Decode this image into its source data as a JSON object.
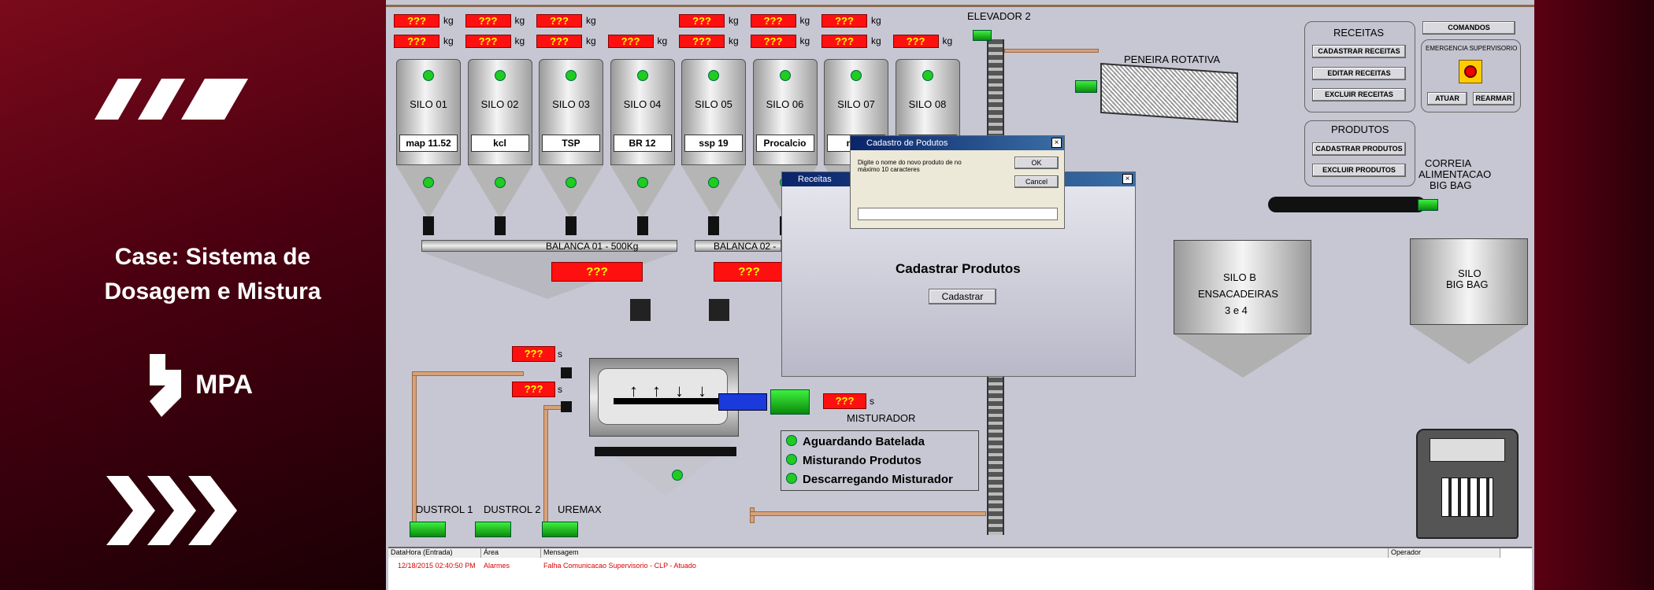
{
  "promo": {
    "title_line1": "Case: Sistema de",
    "title_line2": "Dosagem e Mistura",
    "logo_text": "MPA",
    "brand_color": "#7a0a1c"
  },
  "hmi": {
    "unknown_value": "???",
    "unit_kg": "kg",
    "unit_s": "s",
    "silos": [
      {
        "name": "SILO 01",
        "product": "map 11.52"
      },
      {
        "name": "SILO 02",
        "product": "kcl"
      },
      {
        "name": "SILO 03",
        "product": "TSP"
      },
      {
        "name": "SILO 04",
        "product": "BR 12"
      },
      {
        "name": "SILO 05",
        "product": "ssp 19"
      },
      {
        "name": "SILO 06",
        "product": "Procalcio"
      },
      {
        "name": "SILO 07",
        "product": "map"
      },
      {
        "name": "SILO 08",
        "product": ""
      }
    ],
    "balanca1": "BALANCA 01 - 500Kg",
    "balanca2": "BALANCA 02 -",
    "elevador": "ELEVADOR 2",
    "peneira": "PENEIRA ROTATIVA",
    "correia_line1": "CORREIA",
    "correia_line2": "ALIMENTACAO",
    "correia_line3": "BIG BAG",
    "silo_b_line1": "SILO B",
    "silo_b_line2": "ENSACADEIRAS",
    "silo_b_line3": "3 e 4",
    "silo_bigbag_line1": "SILO",
    "silo_bigbag_line2": "BIG BAG",
    "misturador": "MISTURADOR",
    "dustrol1": "DUSTROL 1",
    "dustrol2": "DUSTROL 2",
    "uremax": "UREMAX",
    "status": [
      "Aguardando Batelada",
      "Misturando Produtos",
      "Descarregando Misturador"
    ],
    "receitas": {
      "title": "RECEITAS",
      "buttons": [
        "CADASTRAR RECEITAS",
        "EDITAR RECEITAS",
        "EXCLUIR RECEITAS"
      ]
    },
    "produtos": {
      "title": "PRODUTOS",
      "buttons": [
        "CADASTRAR PRODUTOS",
        "EXCLUIR PRODUTOS"
      ]
    },
    "comandos": {
      "header": "COMANDOS",
      "emergencia": "EMERGENCIA SUPERVISORIO",
      "atuar": "ATUAR",
      "rearmar": "REARMAR"
    }
  },
  "dialog_receitas": {
    "title": "Receitas",
    "heading": "Cadastrar Produtos",
    "button": "Cadastrar",
    "close": "×"
  },
  "dialog_cadastro": {
    "title": "Cadastro de Podutos",
    "prompt": "Digite o nome do novo produto de no máximo 10 caracteres",
    "ok": "OK",
    "cancel": "Cancel",
    "input_value": "",
    "close": "×"
  },
  "alarms": {
    "columns": [
      "DataHora (Entrada)",
      "Área",
      "Mensagem",
      "Operador"
    ],
    "rows": [
      {
        "datetime": "12/18/2015 02:40:50 PM",
        "area": "Alarmes",
        "message": "Falha Comunicacao Supervisorio - CLP - Atuado",
        "operator": ""
      }
    ]
  }
}
